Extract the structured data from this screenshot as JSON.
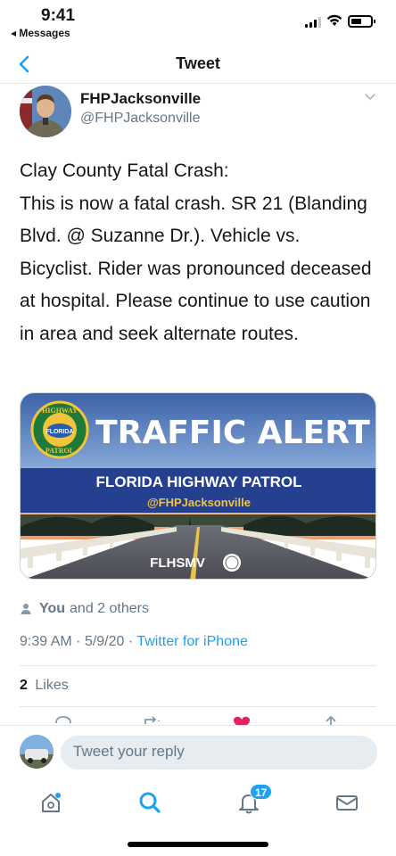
{
  "status_bar": {
    "time": "9:41",
    "back_app": "◂ Messages",
    "battery_level": 0.55
  },
  "nav": {
    "title": "Tweet"
  },
  "tweet": {
    "display_name": "FHPJacksonville",
    "handle": "@FHPJacksonville",
    "text": "Clay County Fatal Crash:\nThis is now a fatal crash. SR 21 (Blanding Blvd. @ Suzanne Dr.). Vehicle vs. Bicyclist. Rider was pronounced deceased at hospital. Please continue to use caution in area and seek alternate routes.",
    "card": {
      "headline": "TRAFFIC ALERT",
      "org": "FLORIDA HIGHWAY PATROL",
      "handle": "@FHPJacksonville",
      "footer_logo": "FLHSMV",
      "badge_top": "HIGHWAY",
      "badge_mid": "FLORIDA",
      "badge_bottom": "PATROL"
    },
    "liked_by_you": "You",
    "liked_by_others": "and 2 others",
    "time": "9:39 AM",
    "date": "5/9/20",
    "separator": "·",
    "source": "Twitter for iPhone",
    "likes_count": "2",
    "likes_label": "Likes"
  },
  "reply": {
    "placeholder": "Tweet your reply"
  },
  "tabs": {
    "notifications_badge": "17"
  },
  "colors": {
    "accent": "#1da1f2",
    "like": "#e0245e",
    "card_band": "#2a3f8f"
  }
}
